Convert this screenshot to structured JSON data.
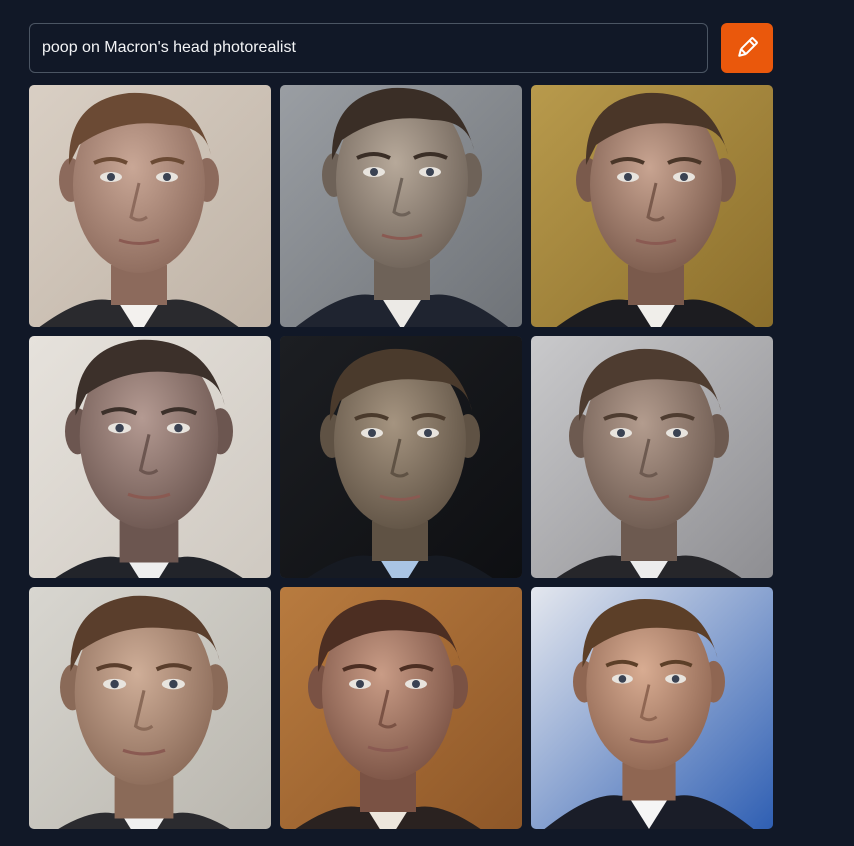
{
  "prompt": {
    "value": "poop on Macron's head photorealist"
  },
  "generate_button": {
    "icon": "pencil-icon",
    "color": "#ea580c"
  },
  "results": [
    {
      "bg": "#d9cfc4",
      "bg2": "#bfb3a6",
      "hair": "#6b4a34",
      "skin": "#c9a796",
      "shadow": "#8c6a5c",
      "suit": "#2a2a2e",
      "shirt": "#f3f1ee"
    },
    {
      "bg": "#9a9ea3",
      "bg2": "#6f7378",
      "hair": "#3a2e26",
      "skin": "#b7a99a",
      "shadow": "#6e6258",
      "suit": "#1f2430",
      "shirt": "#eceae6"
    },
    {
      "bg": "#b89a4c",
      "bg2": "#8c6f2c",
      "hair": "#4a3628",
      "skin": "#c8a491",
      "shadow": "#7a5a4c",
      "suit": "#1c1c20",
      "shirt": "#f0eeea"
    },
    {
      "bg": "#e6e2dc",
      "bg2": "#cfc9c1",
      "hair": "#3c302a",
      "skin": "#b49a92",
      "shadow": "#6c5650",
      "suit": "#22242a",
      "shirt": "#eeeeee"
    },
    {
      "bg": "#1c1e22",
      "bg2": "#0e0f12",
      "hair": "#4a3a2c",
      "skin": "#a59480",
      "shadow": "#5f5244",
      "suit": "#161a22",
      "shirt": "#a9c4e4"
    },
    {
      "bg": "#c9c9cb",
      "bg2": "#8e8e92",
      "hair": "#4e3c30",
      "skin": "#b39c8e",
      "shadow": "#6d5a50",
      "suit": "#26262a",
      "shirt": "#ececec"
    },
    {
      "bg": "#d8d6d0",
      "bg2": "#b9b6ae",
      "hair": "#5a3e2c",
      "skin": "#cfae98",
      "shadow": "#8a6a58",
      "suit": "#2b2b2f",
      "shirt": "#f0f0f0"
    },
    {
      "bg": "#b87b3f",
      "bg2": "#8e5728",
      "hair": "#4c2e22",
      "skin": "#c99c86",
      "shadow": "#7a5244",
      "suit": "#2a2220",
      "shirt": "#ede6dc"
    },
    {
      "bg": "#e4e7ee",
      "bg2": "#2f5fb3",
      "hair": "#5c3f28",
      "skin": "#d8ac92",
      "shadow": "#8f6652",
      "suit": "#1a1d28",
      "shirt": "#f5f5f5"
    }
  ]
}
